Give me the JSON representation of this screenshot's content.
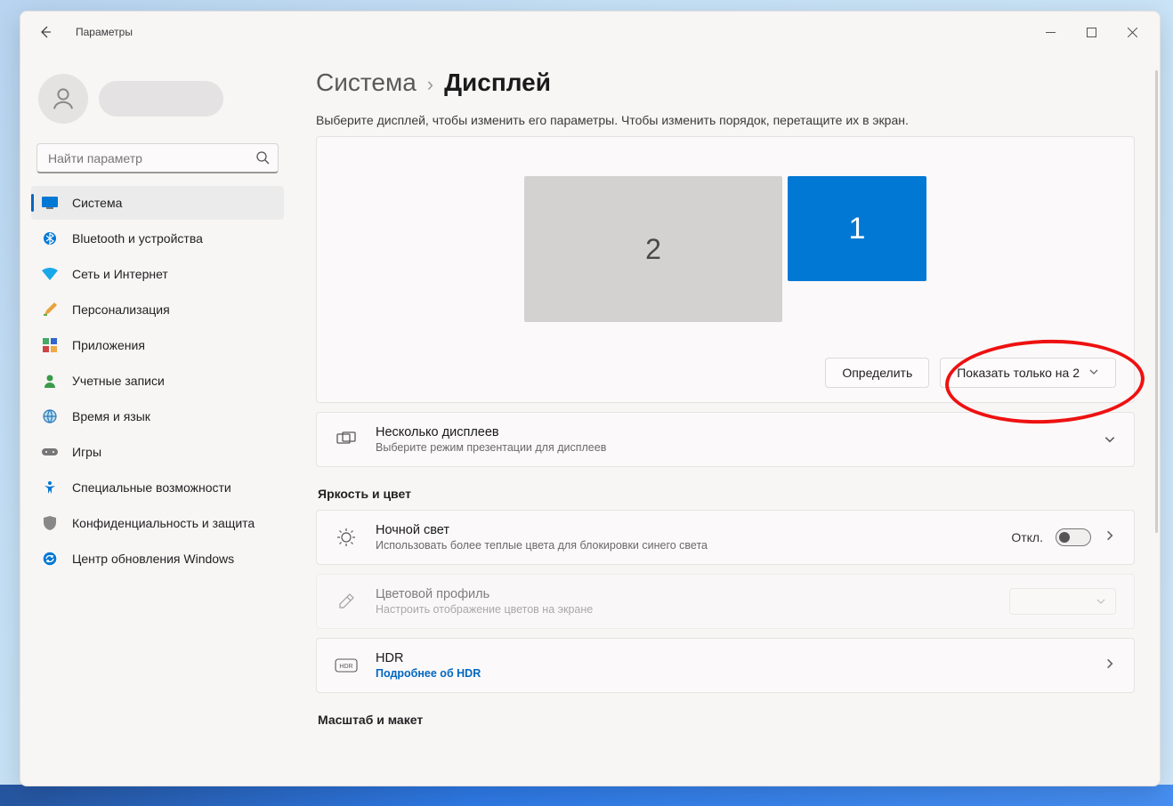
{
  "app_title": "Параметры",
  "search": {
    "placeholder": "Найти параметр"
  },
  "sidebar": {
    "items": [
      {
        "label": "Система"
      },
      {
        "label": "Bluetooth и устройства"
      },
      {
        "label": "Сеть и Интернет"
      },
      {
        "label": "Персонализация"
      },
      {
        "label": "Приложения"
      },
      {
        "label": "Учетные записи"
      },
      {
        "label": "Время и язык"
      },
      {
        "label": "Игры"
      },
      {
        "label": "Специальные возможности"
      },
      {
        "label": "Конфиденциальность и защита"
      },
      {
        "label": "Центр обновления Windows"
      }
    ]
  },
  "breadcrumb": {
    "parent": "Система",
    "current": "Дисплей"
  },
  "display": {
    "description": "Выберите дисплей, чтобы изменить его параметры. Чтобы изменить порядок, перетащите их в экран.",
    "mon2": "2",
    "mon1": "1",
    "identify": "Определить",
    "mode": "Показать только на 2"
  },
  "cards": {
    "multi": {
      "title": "Несколько дисплеев",
      "sub": "Выберите режим презентации для дисплеев"
    },
    "night": {
      "title": "Ночной свет",
      "sub": "Использовать более теплые цвета для блокировки синего света",
      "state": "Откл."
    },
    "color": {
      "title": "Цветовой профиль",
      "sub": "Настроить отображение цветов на экране"
    },
    "hdr": {
      "title": "HDR",
      "link": "Подробнее об HDR"
    }
  },
  "sections": {
    "brightness": "Яркость и цвет",
    "scale": "Масштаб и макет"
  }
}
